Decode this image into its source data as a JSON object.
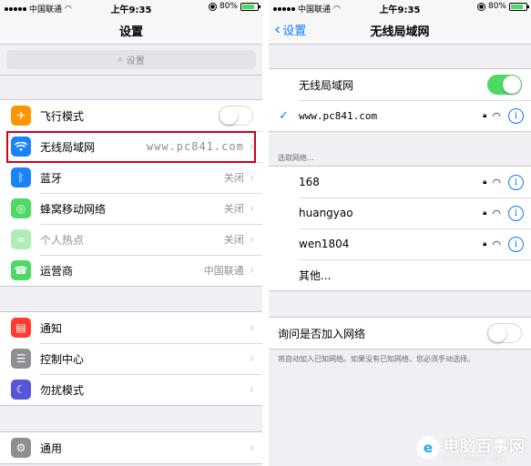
{
  "status": {
    "carrier": "中国联通",
    "time": "上午9:35",
    "battery": "80%",
    "battery_level": 0.8
  },
  "left": {
    "nav_title": "设置",
    "search_placeholder": "设置",
    "group1": [
      {
        "label": "飞行模式",
        "icon": "airplane-icon",
        "color": "#ff9500",
        "toggle": false
      },
      {
        "label": "无线局域网",
        "icon": "wifi-icon",
        "color": "#1a82fb",
        "value": "www.pc841.com"
      },
      {
        "label": "蓝牙",
        "icon": "bluetooth-icon",
        "color": "#1a82fb",
        "value": "关闭"
      },
      {
        "label": "蜂窝移动网络",
        "icon": "cellular-icon",
        "color": "#4cd964",
        "value": "关闭"
      },
      {
        "label": "个人热点",
        "icon": "hotspot-icon",
        "color": "#4cd964",
        "value": "关闭"
      },
      {
        "label": "运营商",
        "icon": "phone-icon",
        "color": "#4cd964",
        "value": "中国联通"
      }
    ],
    "group2": [
      {
        "label": "通知",
        "icon": "notification-icon",
        "color": "#ff3b30"
      },
      {
        "label": "控制中心",
        "icon": "control-center-icon",
        "color": "#8e8e93"
      },
      {
        "label": "勿扰模式",
        "icon": "moon-icon",
        "color": "#5856d6"
      }
    ],
    "group3": [
      {
        "label": "通用",
        "icon": "gear-icon",
        "color": "#8e8e93"
      }
    ]
  },
  "right": {
    "back_label": "设置",
    "nav_title": "无线局域网",
    "wlan_label": "无线局域网",
    "wlan_on": true,
    "connected_network": "www.pc841.com",
    "choose_header": "选取网络...",
    "networks": [
      {
        "name": "168"
      },
      {
        "name": "huangyao"
      },
      {
        "name": "wen1804"
      }
    ],
    "other_label": "其他...",
    "ask_label": "询问是否加入网络",
    "ask_on": false,
    "ask_footer": "将自动加入已知网络。如果没有已知网络，您必须手动选择。"
  },
  "watermark": {
    "logo_char": "e",
    "name": "电脑百事网",
    "url": "WWW.PC841.COM"
  },
  "colors": {
    "ios_blue": "#0a7aff",
    "toggle_on": "#4cd964",
    "highlight": "#d0021b"
  }
}
